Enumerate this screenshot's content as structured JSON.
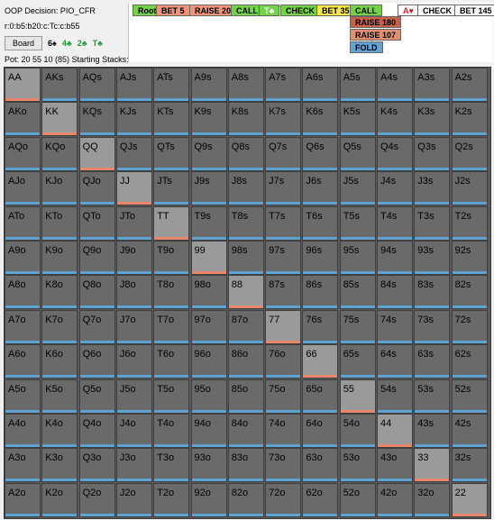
{
  "info": {
    "decision": "OOP Decision:  PIO_CFR",
    "path": "r:0:b5:b20:c:Tc:c:b55",
    "board_button": "Board",
    "board_cards": [
      {
        "text": "6♠",
        "color": "black"
      },
      {
        "text": "4♣",
        "color": "green"
      },
      {
        "text": "2♣",
        "color": "green"
      },
      {
        "text": "T♣",
        "color": "green"
      }
    ],
    "pot": "Pot: 20 55 10 (85) Starting Stacks:200"
  },
  "actions": [
    {
      "label": "Root",
      "bg": "#74d24a",
      "color": "#000"
    },
    {
      "label": "BET 5",
      "bg": "#f0937a",
      "color": "#000"
    },
    {
      "label": "RAISE 20",
      "bg": "#f0937a",
      "color": "#000"
    },
    {
      "label": "CALL",
      "bg": "#74d24a",
      "color": "#000"
    },
    {
      "label": "T♣",
      "bg": "#74d24a",
      "color": "#fff"
    },
    {
      "label": "CHECK",
      "bg": "#74d24a",
      "color": "#000"
    },
    {
      "label": "BET 35",
      "bg": "#f6e64a",
      "color": "#000"
    },
    {
      "label": "CALL",
      "bg": "#74d24a",
      "color": "#000"
    },
    {
      "label": "RAISE 180",
      "bg": "#c7614a",
      "color": "#000"
    },
    {
      "label": "RAISE 107",
      "bg": "#e39072",
      "color": "#000"
    },
    {
      "label": "FOLD",
      "bg": "#62a4d3",
      "color": "#000"
    },
    {
      "label": "A♥",
      "bg": "#ffffff",
      "color": "#d01c1c"
    },
    {
      "label": "CHECK",
      "bg": "#ffffff",
      "color": "#000"
    },
    {
      "label": "BET 145",
      "bg": "#ffffff",
      "color": "#000"
    }
  ],
  "grid": {
    "rows": [
      [
        "AA",
        "AKs",
        "AQs",
        "AJs",
        "ATs",
        "A9s",
        "A8s",
        "A7s",
        "A6s",
        "A5s",
        "A4s",
        "A3s",
        "A2s"
      ],
      [
        "AKo",
        "KK",
        "KQs",
        "KJs",
        "KTs",
        "K9s",
        "K8s",
        "K7s",
        "K6s",
        "K5s",
        "K4s",
        "K3s",
        "K2s"
      ],
      [
        "AQo",
        "KQo",
        "QQ",
        "QJs",
        "QTs",
        "Q9s",
        "Q8s",
        "Q7s",
        "Q6s",
        "Q5s",
        "Q4s",
        "Q3s",
        "Q2s"
      ],
      [
        "AJo",
        "KJo",
        "QJo",
        "JJ",
        "JTs",
        "J9s",
        "J8s",
        "J7s",
        "J6s",
        "J5s",
        "J4s",
        "J3s",
        "J2s"
      ],
      [
        "ATo",
        "KTo",
        "QTo",
        "JTo",
        "TT",
        "T9s",
        "T8s",
        "T7s",
        "T6s",
        "T5s",
        "T4s",
        "T3s",
        "T2s"
      ],
      [
        "A9o",
        "K9o",
        "Q9o",
        "J9o",
        "T9o",
        "99",
        "98s",
        "97s",
        "96s",
        "95s",
        "94s",
        "93s",
        "92s"
      ],
      [
        "A8o",
        "K8o",
        "Q8o",
        "J8o",
        "T8o",
        "98o",
        "88",
        "87s",
        "86s",
        "85s",
        "84s",
        "83s",
        "82s"
      ],
      [
        "A7o",
        "K7o",
        "Q7o",
        "J7o",
        "T7o",
        "97o",
        "87o",
        "77",
        "76s",
        "75s",
        "74s",
        "73s",
        "72s"
      ],
      [
        "A6o",
        "K6o",
        "Q6o",
        "J6o",
        "T6o",
        "96o",
        "86o",
        "76o",
        "66",
        "65s",
        "64s",
        "63s",
        "62s"
      ],
      [
        "A5o",
        "K5o",
        "Q5o",
        "J5o",
        "T5o",
        "95o",
        "85o",
        "75o",
        "65o",
        "55",
        "54s",
        "53s",
        "52s"
      ],
      [
        "A4o",
        "K4o",
        "Q4o",
        "J4o",
        "T4o",
        "94o",
        "84o",
        "74o",
        "64o",
        "54o",
        "44",
        "43s",
        "42s"
      ],
      [
        "A3o",
        "K3o",
        "Q3o",
        "J3o",
        "T3o",
        "93o",
        "83o",
        "73o",
        "63o",
        "53o",
        "43o",
        "33",
        "32s"
      ],
      [
        "A2o",
        "K2o",
        "Q2o",
        "J2o",
        "T2o",
        "92o",
        "82o",
        "72o",
        "62o",
        "52o",
        "42o",
        "32o",
        "22"
      ]
    ],
    "colors": {
      "call": "#7bbf6a",
      "raise": "#e9876a",
      "fold": "#5fa3d3",
      "cell": "#6a6a6a",
      "pair": "#9a9a9a"
    }
  }
}
